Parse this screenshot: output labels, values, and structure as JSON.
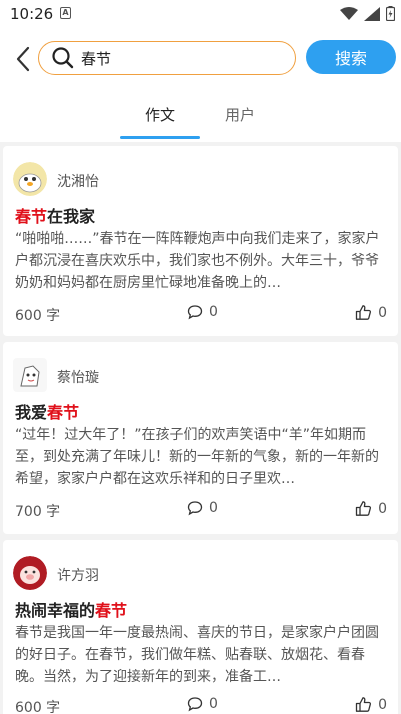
{
  "status_bar": {
    "time": "10:26",
    "sim_label": "A"
  },
  "search": {
    "query": "春节",
    "button_label": "搜索"
  },
  "tabs": [
    {
      "label": "作文",
      "active": true
    },
    {
      "label": "用户",
      "active": false
    }
  ],
  "articles": [
    {
      "author": "沈湘怡",
      "title_highlight": "春节",
      "title_rest": "在我家",
      "excerpt": "“啪啪啪……”春节在一阵阵鞭炮声中向我们走来了，家家户户都沉浸在喜庆欢乐中，我们家也不例外。大年三十，爷爷奶奶和妈妈都在厨房里忙碌地准备晚上的…",
      "word_count": "600 字",
      "comments": "0",
      "likes": "0"
    },
    {
      "author": "蔡怡璇",
      "title_prefix": "我爱",
      "title_highlight": "春节",
      "excerpt": "“过年！过大年了！”在孩子们的欢声笑语中“羊”年如期而至，到处充满了年味儿！新的一年新的气象，新的一年新的希望，家家户户都在这欢乐祥和的日子里欢…",
      "word_count": "700 字",
      "comments": "0",
      "likes": "0"
    },
    {
      "author": "许方羽",
      "title_prefix": "热闹幸福的",
      "title_highlight": "春节",
      "excerpt": "春节是我国一年一度最热闹、喜庆的节日，是家家户户团圆的好日子。在春节，我们做年糕、贴春联、放烟花、看春晚。当然，为了迎接新年的到来，准备工…",
      "word_count": "600 字",
      "comments": "0",
      "likes": "0"
    }
  ],
  "colors": {
    "accent": "#2ea0f0",
    "search_border": "#f0a040",
    "highlight": "#e0101a"
  }
}
